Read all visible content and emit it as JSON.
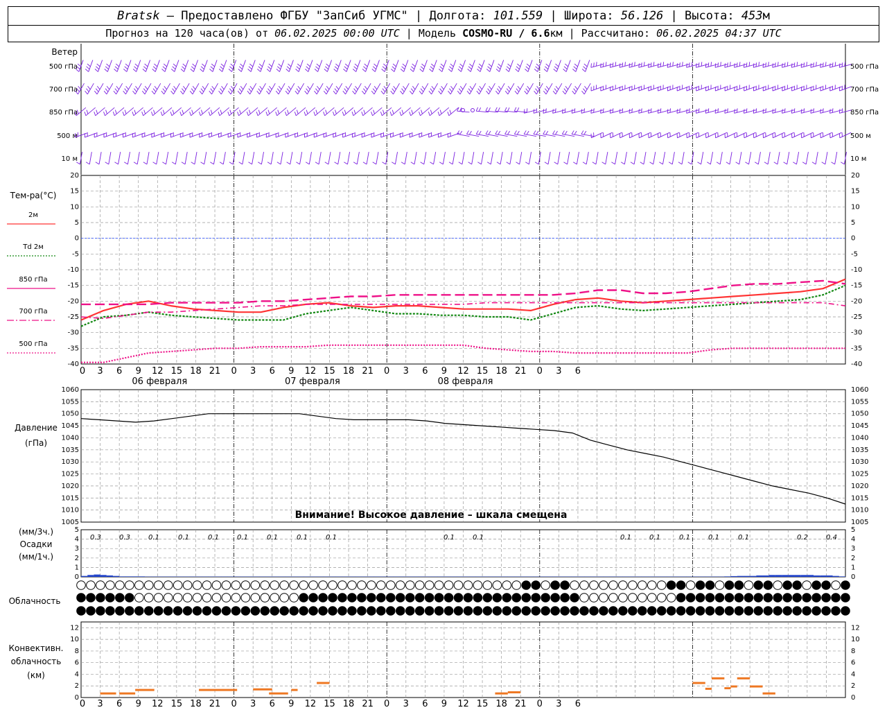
{
  "header": {
    "station": "Bratsk",
    "provided_by": " – Предоставлено ФГБУ \"ЗапСиб УГМС\" | Долгота: ",
    "longitude": "101.559",
    "lat_label": " | Широта: ",
    "latitude": "56.126",
    "alt_label": " | Высота: ",
    "altitude": "453",
    "alt_unit": "м",
    "forecast_prefix": "Прогноз на 120 часа(ов) от ",
    "forecast_start": "06.02.2025 00:00 UTC",
    "model_label": " | Модель ",
    "model": "COSMO-RU / 6.6",
    "model_unit": "км",
    "computed_label": " | Рассчитано: ",
    "computed": "06.02.2025 04:37 UTC"
  },
  "wind_panel": {
    "title": "Ветер",
    "levels": [
      "500 гПа",
      "700 гПа",
      "850 гПа",
      "500 м",
      "10 м"
    ]
  },
  "temp_panel": {
    "title": "Тем-ра(°C)",
    "legend": [
      {
        "label": "2м",
        "color": "#ff3333",
        "style": "solid"
      },
      {
        "label": "Td  2м",
        "color": "#118811",
        "style": "dotted"
      },
      {
        "label": "850 гПа",
        "color": "#ee1188",
        "style": "solid"
      },
      {
        "label": "700 гПа",
        "color": "#ee1188",
        "style": "dashdot"
      },
      {
        "label": "500 гПа",
        "color": "#ee1188",
        "style": "dotted"
      }
    ],
    "y_ticks": [
      "20",
      "15",
      "10",
      "5",
      "0",
      "-5",
      "-10",
      "-15",
      "-20",
      "-25",
      "-30",
      "-35",
      "-40"
    ]
  },
  "time_axis": {
    "hour_labels": [
      "0",
      "3",
      "6",
      "9",
      "12",
      "15",
      "18",
      "21",
      "0",
      "3",
      "6",
      "9",
      "12",
      "15",
      "18",
      "21",
      "0",
      "3",
      "6",
      "9",
      "12",
      "15",
      "18",
      "21",
      "0",
      "3",
      "6"
    ],
    "dates": [
      "06 февраля",
      "07 февраля",
      "08 февраля"
    ]
  },
  "pressure_panel": {
    "title": "Давление",
    "unit": "(гПа)",
    "warning": "Внимание! Высокое давление – шкала смещена",
    "y_ticks": [
      "1060",
      "1055",
      "1050",
      "1045",
      "1040",
      "1035",
      "1030",
      "1025",
      "1020",
      "1015",
      "1010",
      "1005"
    ]
  },
  "precip_panel": {
    "unit3": "(мм/3ч.)",
    "title": "Осадки",
    "unit1": "(мм/1ч.)",
    "y_ticks": [
      "5",
      "4",
      "3",
      "2",
      "1",
      "0"
    ],
    "labels": [
      "0.3",
      "0.3",
      "0.1",
      "0.1",
      "0.1",
      "0.1",
      "0.1",
      "0.1",
      "0.1",
      "0.1",
      "0.1",
      "0.1",
      "0.1",
      "0.1",
      "0.1",
      "0.1",
      "0.2",
      "0.4"
    ]
  },
  "cloud_panel": {
    "title": "Облачность"
  },
  "conv_panel": {
    "title1": "Конвективн.",
    "title2": "облачность",
    "unit": "(км)",
    "y_ticks": [
      "12",
      "10",
      "8",
      "6",
      "4",
      "2",
      "0"
    ]
  },
  "colors": {
    "wind": "#7a1fe0",
    "t2m": "#ff3333",
    "td2m": "#118811",
    "t850": "#ee1188",
    "zero_line": "#3355ff",
    "precip": "#2244cc",
    "conv": "#ee7722",
    "grid": "#999999"
  },
  "chart_data": [
    {
      "type": "line",
      "name": "temperature",
      "x_hours": [
        0,
        3,
        6,
        9,
        12,
        15,
        18,
        21,
        24,
        27,
        30,
        33,
        36,
        39,
        42,
        45,
        48,
        51,
        54,
        57,
        60,
        63,
        66,
        69,
        72,
        75,
        78,
        81,
        84,
        87,
        90,
        93,
        96,
        99,
        102,
        105,
        108,
        111,
        114,
        117,
        120
      ],
      "series": [
        {
          "name": "2м",
          "values": [
            -26,
            -23,
            -21,
            -20,
            -21.5,
            -22.5,
            -23,
            -23.5,
            -23.5,
            -22,
            -21,
            -20.5,
            -21.5,
            -22,
            -21.5,
            -21.5,
            -22,
            -22.5,
            -22.5,
            -22.5,
            -23,
            -21,
            -19.5,
            -19,
            -20,
            -20.5,
            -20,
            -19.5,
            -19,
            -18.5,
            -18,
            -17.5,
            -17,
            -16,
            -13
          ]
        },
        {
          "name": "Td  2м",
          "values": [
            -28,
            -25,
            -24.5,
            -23.5,
            -24.5,
            -25,
            -25.5,
            -26,
            -26,
            -26,
            -24,
            -23,
            -22,
            -23,
            -24,
            -24,
            -24.5,
            -24.5,
            -25,
            -25,
            -26,
            -24,
            -22,
            -21.5,
            -22.5,
            -23,
            -22.5,
            -22,
            -21.5,
            -21,
            -20.5,
            -20,
            -19.5,
            -18,
            -15
          ]
        },
        {
          "name": "850 гПа",
          "values": [
            -21,
            -21,
            -21,
            -21,
            -20.5,
            -20.5,
            -20.5,
            -20.5,
            -20,
            -20,
            -19.5,
            -19,
            -18.5,
            -18.5,
            -18,
            -18,
            -18,
            -18,
            -18,
            -18,
            -18,
            -18,
            -17.5,
            -16.5,
            -16.5,
            -17.5,
            -17.5,
            -17,
            -16,
            -15,
            -14.5,
            -14.5,
            -14,
            -13.5,
            -14.5
          ]
        },
        {
          "name": "700 гПа",
          "values": [
            -25,
            -25.5,
            -24.5,
            -23.5,
            -23.5,
            -23,
            -22.5,
            -22,
            -21.5,
            -21.5,
            -21,
            -21,
            -21,
            -21,
            -21,
            -21,
            -21,
            -21,
            -20.5,
            -20.5,
            -20.5,
            -20.5,
            -20.5,
            -20.5,
            -20.5,
            -20.5,
            -20.5,
            -20.5,
            -20.5,
            -20.5,
            -20.5,
            -20.5,
            -20.5,
            -20.5,
            -21.5
          ]
        },
        {
          "name": "500 гПа",
          "values": [
            -39.5,
            -39.5,
            -38,
            -36.5,
            -36,
            -35.5,
            -35,
            -35,
            -34.5,
            -34.5,
            -34.5,
            -34,
            -34,
            -34,
            -34,
            -34,
            -34,
            -34,
            -35,
            -35.5,
            -36,
            -36,
            -36.5,
            -36.5,
            -36.5,
            -36.5,
            -36.5,
            -36.5,
            -35.5,
            -35,
            -35,
            -35,
            -35,
            -35,
            -35
          ]
        }
      ],
      "ylim": [
        -40,
        20
      ]
    },
    {
      "type": "line",
      "name": "pressure",
      "x_hours": [
        0,
        3,
        6,
        9,
        12,
        15,
        18,
        21,
        24,
        27,
        30,
        33,
        36,
        39,
        42,
        45,
        48,
        51,
        54,
        57,
        60,
        63,
        66,
        69,
        72,
        75,
        78,
        81,
        84,
        87,
        90,
        93,
        96,
        99,
        102,
        105,
        108,
        111,
        114,
        117,
        120
      ],
      "values": [
        1048,
        1047.5,
        1047,
        1046.5,
        1047,
        1048,
        1049,
        1050,
        1050,
        1050,
        1050,
        1050,
        1050,
        1049,
        1048,
        1047.5,
        1047.5,
        1047.5,
        1047.5,
        1047,
        1046,
        1045.5,
        1045,
        1044.5,
        1044,
        1043.5,
        1043,
        1042,
        1039,
        1037,
        1035,
        1033.5,
        1032,
        1030,
        1028,
        1026,
        1024,
        1022,
        1020,
        1018.5,
        1017,
        1015,
        1012.5
      ],
      "ylim": [
        1005,
        1060
      ]
    },
    {
      "type": "bar",
      "name": "precip_1h",
      "x_hours": [
        1,
        2,
        3,
        4,
        5,
        6,
        7,
        8,
        9,
        10,
        11,
        12,
        13,
        14,
        15,
        16,
        17,
        18,
        19,
        20,
        21,
        22,
        23,
        24,
        25,
        26,
        27,
        28,
        29,
        30,
        31,
        32,
        33,
        34,
        35,
        36,
        37,
        38,
        39,
        40,
        41,
        42,
        43,
        44,
        45,
        46,
        47,
        48,
        49,
        50,
        51,
        52,
        53,
        54,
        55,
        56,
        57,
        58,
        59,
        60,
        61,
        62,
        63,
        64,
        65,
        66,
        67,
        68,
        69,
        70,
        71,
        72,
        73,
        74,
        75,
        76,
        77,
        78,
        79,
        80,
        81,
        82,
        83,
        84,
        85,
        86,
        87,
        88,
        89,
        90,
        91,
        92,
        93,
        94,
        95,
        96,
        97,
        98,
        99,
        100,
        101,
        102,
        103,
        104,
        105,
        106,
        107,
        108,
        109,
        110,
        111,
        112,
        113,
        114,
        115,
        116,
        117,
        118,
        119,
        120
      ],
      "values": [
        0.1,
        0.2,
        0.25,
        0.2,
        0.15,
        0.1,
        0.05,
        0.05,
        0.05,
        0.05,
        0.03,
        0.03,
        0.03,
        0.03,
        0.03,
        0.03,
        0.03,
        0.03,
        0.03,
        0.03,
        0.03,
        0.03,
        0.03,
        0.03,
        0.03,
        0.03,
        0.03,
        0.03,
        0.03,
        0.03,
        0.03,
        0.03,
        0.03,
        0.03,
        0.03,
        0.03,
        0.03,
        0.03,
        0.03,
        0.03,
        0.03,
        0.03,
        0.03,
        0.03,
        0.03,
        0.03,
        0.03,
        0.03,
        0.03,
        0.03,
        0.03,
        0.03,
        0.03,
        0.03,
        0.03,
        0.03,
        0.03,
        0.03,
        0.03,
        0.03,
        0.03,
        0.03,
        0.03,
        0.03,
        0.03,
        0.03,
        0.03,
        0.03,
        0.03,
        0.03,
        0.03,
        0.03,
        0.03,
        0.03,
        0.03,
        0.03,
        0.03,
        0.03,
        0.03,
        0.03,
        0.03,
        0.03,
        0.03,
        0.03,
        0.03,
        0.03,
        0.03,
        0.03,
        0.03,
        0.03,
        0.03,
        0.03,
        0.03,
        0.03,
        0.03,
        0.03,
        0.03,
        0.03,
        0.03,
        0.03,
        0.03,
        0.05,
        0.08,
        0.1,
        0.1,
        0.1,
        0.15,
        0.15,
        0.2,
        0.2,
        0.2,
        0.2,
        0.2,
        0.2,
        0.2,
        0.15,
        0.15,
        0.15,
        0.1,
        0.05
      ],
      "ylim": [
        0,
        5
      ]
    },
    {
      "type": "bar",
      "name": "convective_cloud",
      "segments": [
        {
          "start": 3,
          "end": 5.5,
          "value": 0.7
        },
        {
          "start": 6,
          "end": 8.5,
          "value": 0.7
        },
        {
          "start": 8.5,
          "end": 11.5,
          "value": 1.3
        },
        {
          "start": 18.5,
          "end": 24.5,
          "value": 1.3
        },
        {
          "start": 27,
          "end": 30,
          "value": 1.4
        },
        {
          "start": 29.5,
          "end": 32.5,
          "value": 0.7
        },
        {
          "start": 33,
          "end": 34,
          "value": 1.3
        },
        {
          "start": 37,
          "end": 39,
          "value": 2.5
        },
        {
          "start": 65,
          "end": 67,
          "value": 0.7
        },
        {
          "start": 67,
          "end": 69,
          "value": 0.9
        },
        {
          "start": 96,
          "end": 98,
          "value": 2.5
        },
        {
          "start": 98,
          "end": 99,
          "value": 1.5
        },
        {
          "start": 99,
          "end": 101,
          "value": 3.3
        },
        {
          "start": 101,
          "end": 102,
          "value": 1.6
        },
        {
          "start": 102,
          "end": 103,
          "value": 1.9
        },
        {
          "start": 103,
          "end": 105,
          "value": 3.3
        },
        {
          "start": 105,
          "end": 107,
          "value": 1.9
        },
        {
          "start": 107,
          "end": 109,
          "value": 0.7
        }
      ],
      "ylim": [
        0,
        13
      ]
    }
  ]
}
